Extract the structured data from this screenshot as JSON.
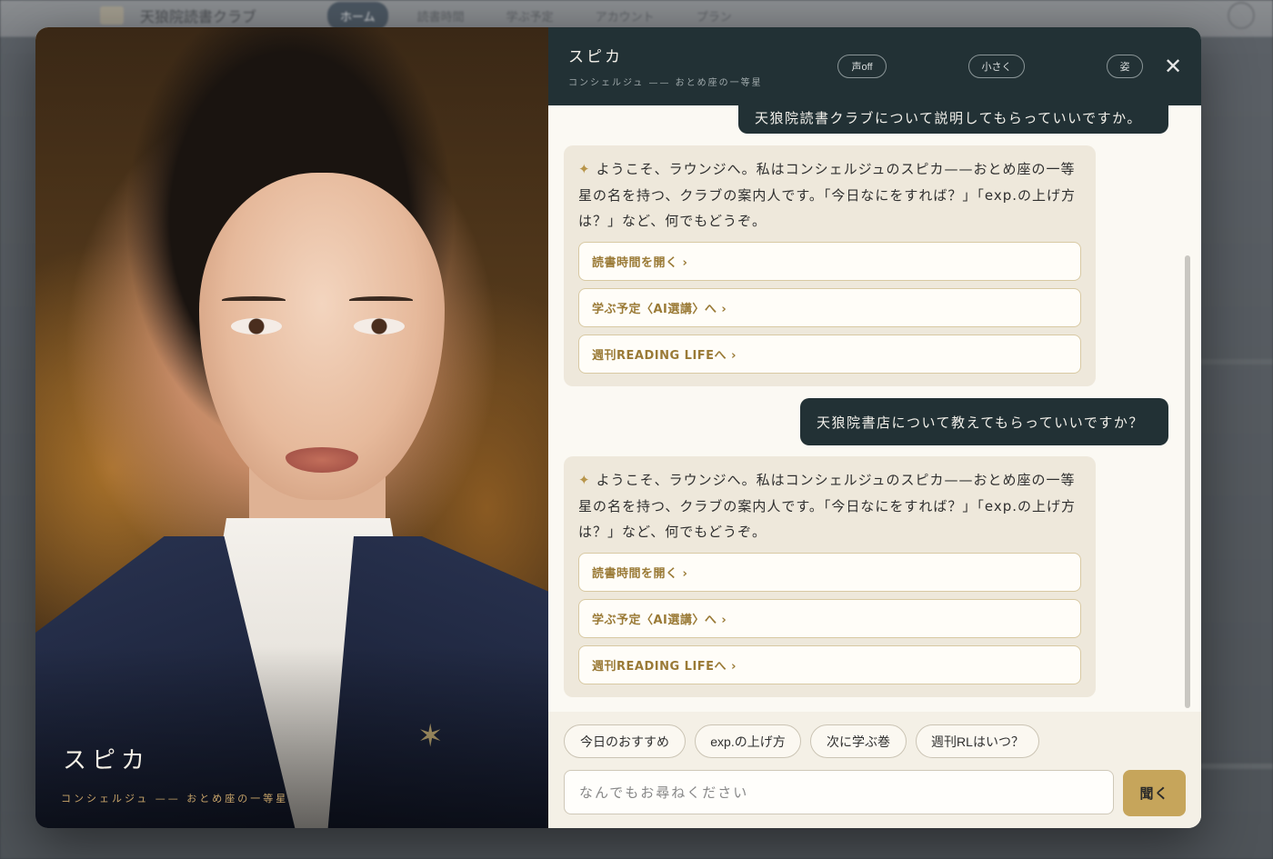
{
  "background": {
    "app_title": "天狼院読書クラブ",
    "nav": [
      "ホーム",
      "読書時間",
      "学ぶ予定",
      "アカウント",
      "プラン"
    ]
  },
  "portrait": {
    "name": "スピカ",
    "subtitle": "コンシェルジュ —— おとめ座の一等星"
  },
  "header": {
    "name": "スピカ",
    "subtitle": "コンシェルジュ —— おとめ座の一等星",
    "voice_label": "声off",
    "small_label": "小さく",
    "figure_label": "姿",
    "close_icon": "close-icon"
  },
  "messages": {
    "user1": "天狼院読書クラブについて説明してもらっていいですか。",
    "bot1": {
      "text": "ようこそ、ラウンジへ。私はコンシェルジュのスピカ——おとめ座の一等星の名を持つ、クラブの案内人です。「今日なにをすれば？」「exp.の上げ方は？」など、何でもどうぞ。",
      "links": [
        "読書時間を開く ›",
        "学ぶ予定〈AI選講〉へ ›",
        "週刊READING LIFEへ ›"
      ]
    },
    "user2": "天狼院書店について教えてもらっていいですか？",
    "bot2": {
      "text": "ようこそ、ラウンジへ。私はコンシェルジュのスピカ——おとめ座の一等星の名を持つ、クラブの案内人です。「今日なにをすれば？」「exp.の上げ方は？」など、何でもどうぞ。",
      "links": [
        "読書時間を開く ›",
        "学ぶ予定〈AI選講〉へ ›",
        "週刊READING LIFEへ ›"
      ]
    }
  },
  "suggestions": [
    "今日のおすすめ",
    "exp.の上げ方",
    "次に学ぶ巻",
    "週刊RLはいつ？"
  ],
  "input": {
    "placeholder": "なんでもお尋ねください",
    "value": ""
  },
  "send_label": "聞く",
  "colors": {
    "header_bg": "#223135",
    "accent_gold": "#c6a55b",
    "bot_bubble": "#eee8db",
    "user_bubble": "#223135"
  }
}
